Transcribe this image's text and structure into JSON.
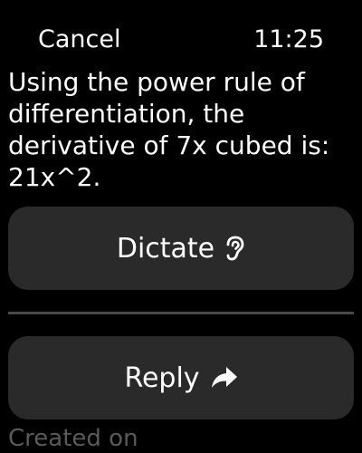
{
  "header": {
    "cancel_label": "Cancel",
    "time": "11:25"
  },
  "message": {
    "text": "Using the power rule of differentiation, the derivative of 7x cubed is: 21x^2."
  },
  "actions": {
    "dictate_label": "Dictate",
    "dictate_icon": "ear-icon",
    "reply_label": "Reply",
    "reply_icon": "reply-arrow-icon"
  },
  "footer": {
    "text": "Created on"
  },
  "colors": {
    "background": "#000000",
    "button_bg": "#2a2a2a",
    "text": "#ffffff",
    "divider": "#4a4a4a",
    "muted_text": "#5a5a5a"
  }
}
